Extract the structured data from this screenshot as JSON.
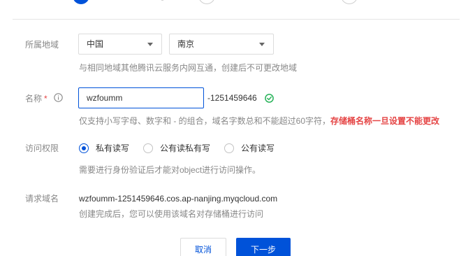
{
  "form": {
    "region": {
      "label": "所属地域",
      "country_value": "中国",
      "city_value": "南京",
      "hint": "与相同地域其他腾讯云服务内网互通，创建后不可更改地域"
    },
    "name": {
      "label": "名称",
      "required_mark": "*",
      "input_value": "wzfoumm",
      "suffix": "-1251459646",
      "hint": "仅支持小写字母、数字和 - 的组合，域名字数总和不能超过60字符，",
      "warning": "存储桶名称一旦设置不能更改"
    },
    "access": {
      "label": "访问权限",
      "options": [
        "私有读写",
        "公有读私有写",
        "公有读写"
      ],
      "selected": "私有读写",
      "hint": "需要进行身份验证后才能对object进行访问操作。"
    },
    "request_domain": {
      "label": "请求域名",
      "value": "wzfoumm-1251459646.cos.ap-nanjing.myqcloud.com",
      "hint": "创建完成后，您可以使用该域名对存储桶进行访问"
    }
  },
  "actions": {
    "cancel_label": "取消",
    "next_label": "下一步"
  },
  "colors": {
    "primary": "#0052d9",
    "error": "#e54545",
    "success": "#29b35a"
  }
}
